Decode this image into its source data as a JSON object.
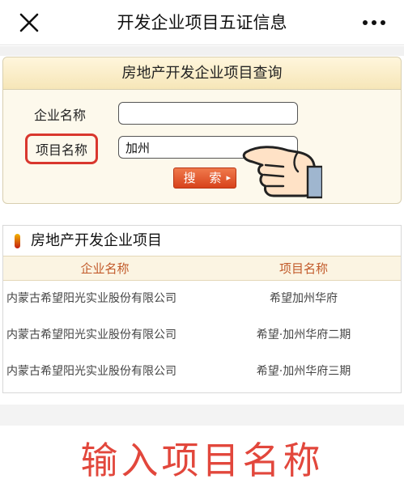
{
  "topbar": {
    "title": "开发企业项目五证信息",
    "close_icon": "close-icon",
    "more_icon": "more-dots-icon"
  },
  "query": {
    "header": "房地产开发企业项目查询",
    "company_label": "企业名称",
    "company_value": "",
    "project_label": "项目名称",
    "project_value": "加州",
    "search_label": "搜 索",
    "search_arrow": "▸",
    "highlight_color": "#d9372e"
  },
  "results": {
    "header": "房地产开发企业项目",
    "columns": [
      "企业名称",
      "项目名称"
    ],
    "rows": [
      [
        "内蒙古希望阳光实业股份有限公司",
        "希望加州华府"
      ],
      [
        "内蒙古希望阳光实业股份有限公司",
        "希望·加州华府二期"
      ],
      [
        "内蒙古希望阳光实业股份有限公司",
        "希望·加州华府三期"
      ]
    ]
  },
  "caption": {
    "text": "输入项目名称",
    "color": "#e2473c"
  }
}
